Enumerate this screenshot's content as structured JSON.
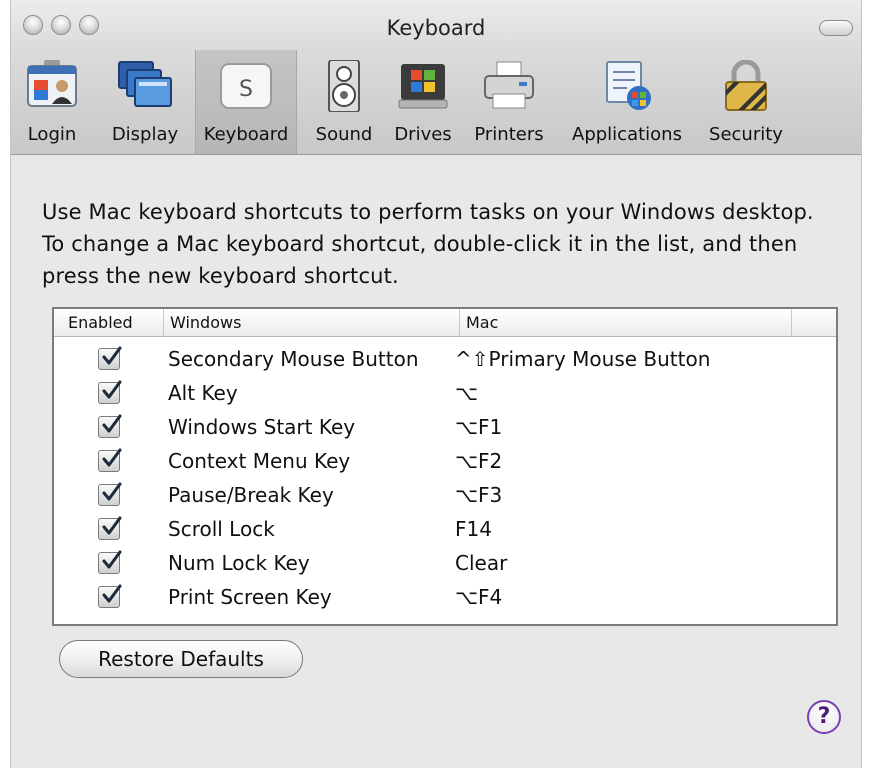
{
  "window": {
    "title": "Keyboard"
  },
  "toolbar": {
    "items": [
      {
        "label": "Login",
        "icon": "login-id-card-icon"
      },
      {
        "label": "Display",
        "icon": "display-monitors-icon"
      },
      {
        "label": "Keyboard",
        "icon": "keyboard-key-icon",
        "selected": true,
        "key_glyph": "S"
      },
      {
        "label": "Sound",
        "icon": "speaker-icon"
      },
      {
        "label": "Drives",
        "icon": "drive-icon"
      },
      {
        "label": "Printers",
        "icon": "printer-icon"
      },
      {
        "label": "Applications",
        "icon": "applications-icon"
      },
      {
        "label": "Security",
        "icon": "padlock-icon"
      }
    ]
  },
  "description": "Use Mac keyboard shortcuts to perform tasks on your Windows desktop. To change a Mac keyboard shortcut, double-click it in the list, and then press the new keyboard shortcut.",
  "table": {
    "columns": {
      "enabled": "Enabled",
      "windows": "Windows",
      "mac": "Mac"
    },
    "rows": [
      {
        "enabled": true,
        "windows": "Secondary Mouse Button",
        "mac": "^⇧Primary Mouse Button"
      },
      {
        "enabled": true,
        "windows": "Alt Key",
        "mac": "⌥"
      },
      {
        "enabled": true,
        "windows": "Windows Start Key",
        "mac": "⌥F1"
      },
      {
        "enabled": true,
        "windows": "Context Menu Key",
        "mac": "⌥F2"
      },
      {
        "enabled": true,
        "windows": "Pause/Break Key",
        "mac": "⌥F3"
      },
      {
        "enabled": true,
        "windows": "Scroll Lock",
        "mac": "F14"
      },
      {
        "enabled": true,
        "windows": "Num Lock Key",
        "mac": "Clear"
      },
      {
        "enabled": true,
        "windows": "Print Screen Key",
        "mac": "⌥F4"
      }
    ]
  },
  "buttons": {
    "restore_defaults": "Restore Defaults",
    "help": "?"
  },
  "colors": {
    "help_ring": "#7b3fb3",
    "window_bg": "#e8e8e8"
  }
}
